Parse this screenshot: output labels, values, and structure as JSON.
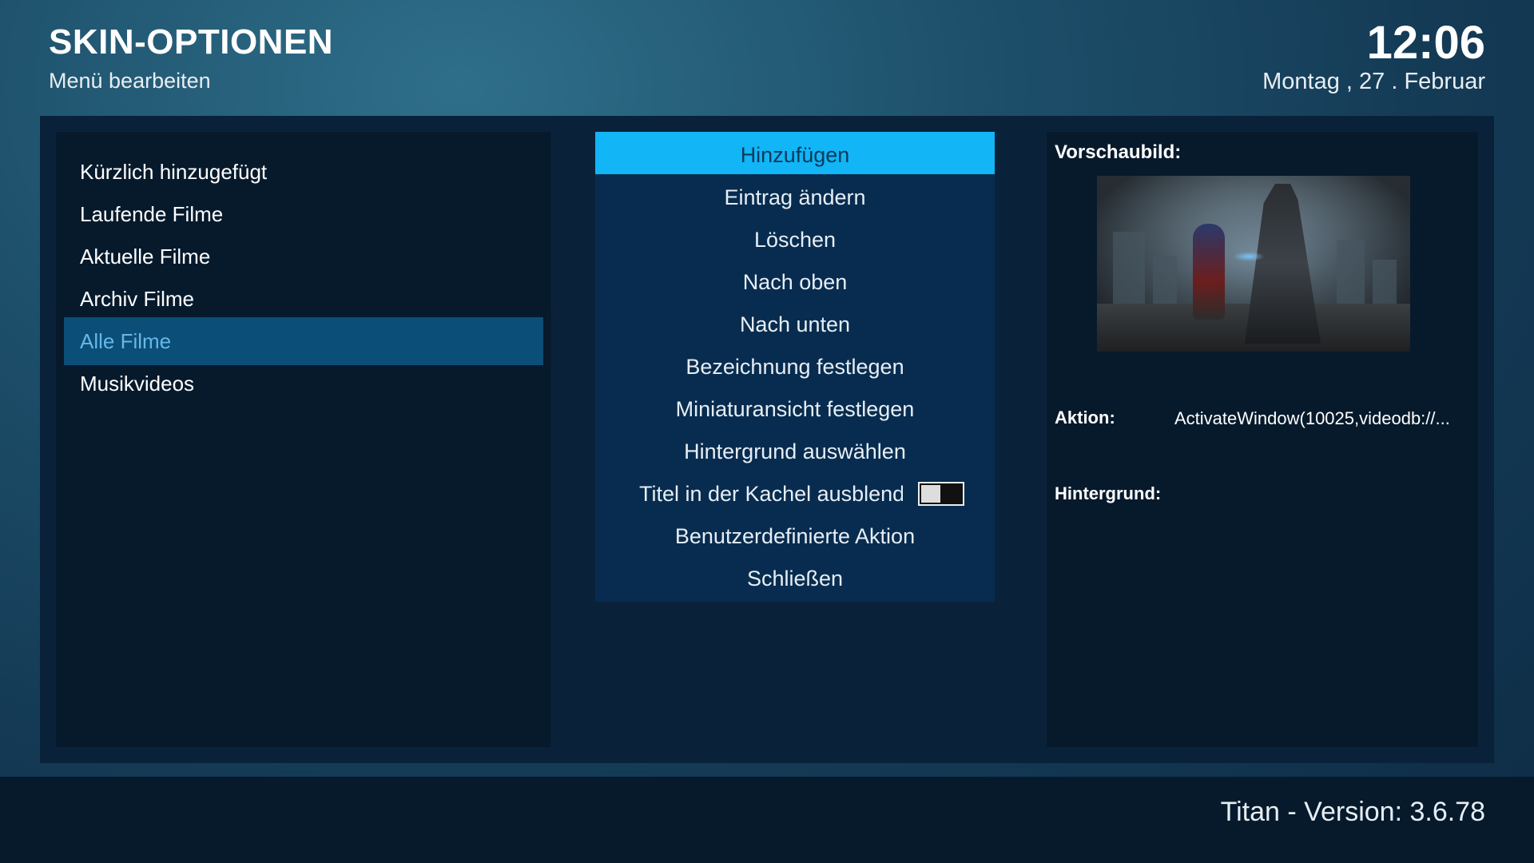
{
  "header": {
    "title": "SKIN-OPTIONEN",
    "subtitle": "Menü bearbeiten",
    "time": "12:06",
    "date": "Montag , 27 . Februar"
  },
  "menu_items": [
    {
      "label": "Kürzlich hinzugefügt",
      "selected": false
    },
    {
      "label": "Laufende Filme",
      "selected": false
    },
    {
      "label": "Aktuelle Filme",
      "selected": false
    },
    {
      "label": "Archiv Filme",
      "selected": false
    },
    {
      "label": "Alle Filme",
      "selected": true
    },
    {
      "label": "Musikvideos",
      "selected": false
    }
  ],
  "actions": [
    {
      "label": "Hinzufügen",
      "focused": true
    },
    {
      "label": "Eintrag ändern"
    },
    {
      "label": "Löschen"
    },
    {
      "label": "Nach oben"
    },
    {
      "label": "Nach unten"
    },
    {
      "label": "Bezeichnung festlegen"
    },
    {
      "label": "Miniaturansicht festlegen"
    },
    {
      "label": "Hintergrund auswählen"
    },
    {
      "label": "Titel in der Kachel ausblenden",
      "toggle": false
    },
    {
      "label": "Benutzerdefinierte Aktion"
    },
    {
      "label": "Schließen"
    }
  ],
  "details": {
    "preview_label": "Vorschaubild:",
    "action_label": "Aktion:",
    "action_value": "ActivateWindow(10025,videodb://...",
    "background_label": "Hintergrund:",
    "background_value": ""
  },
  "footer": {
    "version": "Titan - Version: 3.6.78"
  },
  "colors": {
    "focused_button": "#12b5f6",
    "button": "#082c4f",
    "selected_item": "#0b4e78",
    "selected_text": "#66b8e8"
  }
}
